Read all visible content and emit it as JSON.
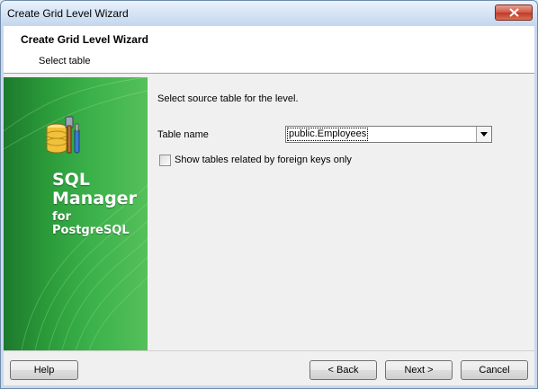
{
  "window": {
    "title": "Create Grid Level Wizard"
  },
  "header": {
    "title": "Create Grid Level Wizard",
    "subtitle": "Select table"
  },
  "sidebar": {
    "brand_line1": "SQL",
    "brand_line2": "Manager",
    "brand_line3": "for",
    "brand_line4": "PostgreSQL",
    "logo_icon": "database-tools-icon"
  },
  "main": {
    "instruction": "Select source table for the level.",
    "table_name_label": "Table name",
    "table_name_value": "public.Employees",
    "foreign_keys_label": "Show tables related by foreign keys only",
    "foreign_keys_checked": false
  },
  "footer": {
    "help_label": "Help",
    "back_label": "< Back",
    "next_label": "Next >",
    "cancel_label": "Cancel"
  },
  "colors": {
    "sidebar_green": "#2b9a3a",
    "close_red": "#c0392b",
    "titlebar": "#c4d7ef"
  }
}
